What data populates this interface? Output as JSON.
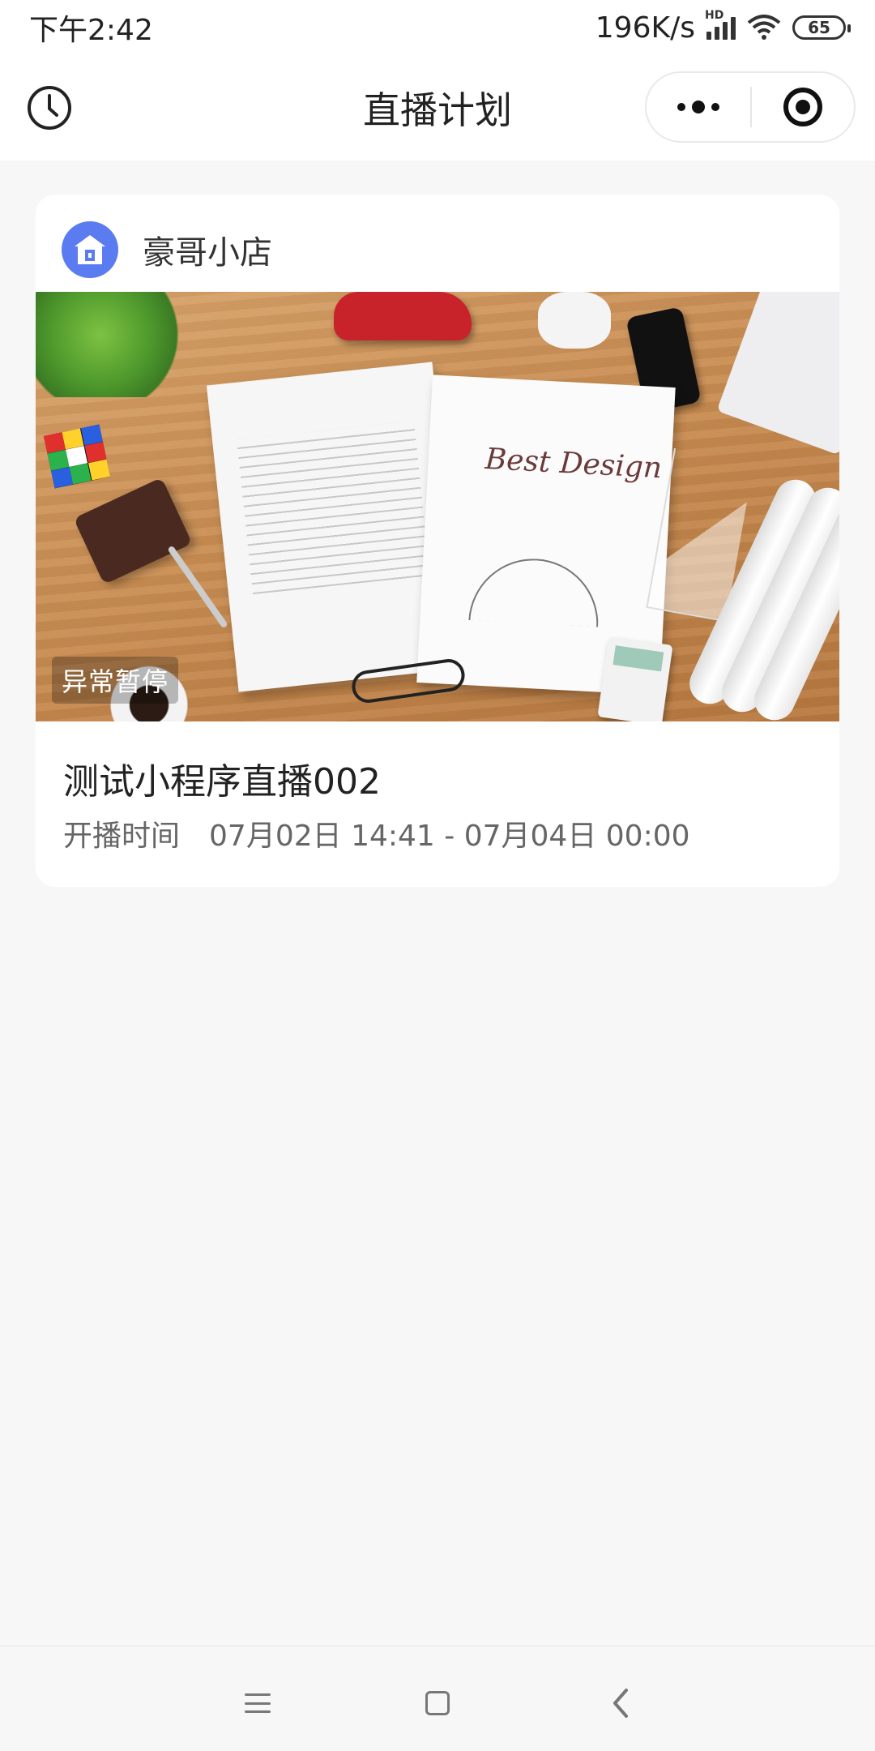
{
  "status_bar": {
    "time": "下午2:42",
    "network_speed": "196K/s",
    "hd_label": "HD",
    "battery": "65"
  },
  "nav": {
    "title": "直播计划",
    "history_icon": "clock-icon",
    "more_icon": "more-dots-icon",
    "close_icon": "target-close-icon"
  },
  "live_card": {
    "shop_name": "豪哥小店",
    "shop_icon": "shop-house-icon",
    "cover_status": "异常暂停",
    "cover_art_text": "Best Design",
    "title": "测试小程序直播002",
    "time_label": "开播时间",
    "time_range": "07月02日 14:41 - 07月04日 00:00"
  },
  "system_nav": {
    "menu_icon": "menu-lines-icon",
    "home_icon": "home-square-icon",
    "back_icon": "back-chevron-icon"
  },
  "colors": {
    "accent_blue": "#5b7cf1",
    "background": "#f7f7f7",
    "card": "#ffffff"
  }
}
